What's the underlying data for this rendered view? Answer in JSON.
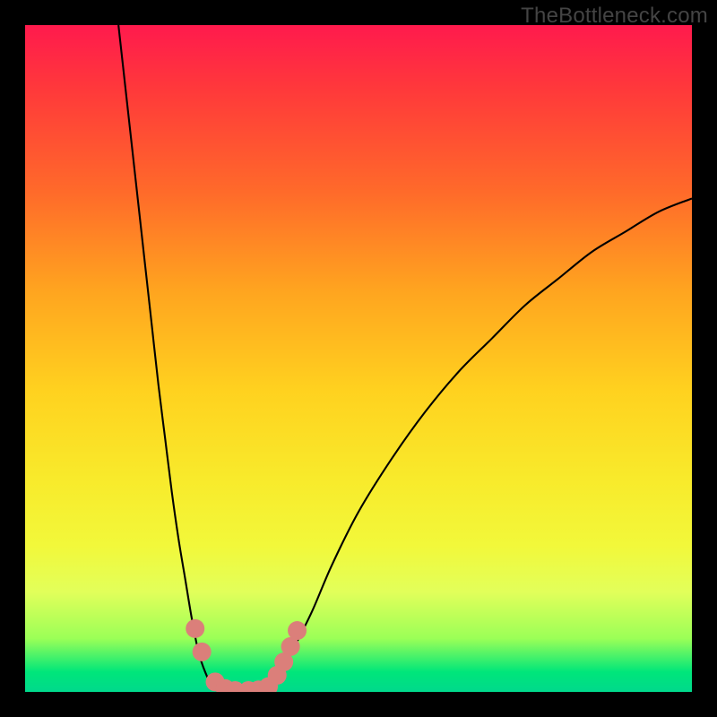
{
  "watermark": "TheBottleneck.com",
  "chart_data": {
    "type": "line",
    "title": "",
    "xlabel": "",
    "ylabel": "",
    "xlim": [
      0,
      100
    ],
    "ylim": [
      0,
      100
    ],
    "grid": false,
    "legend": null,
    "notes": "Bottleneck percentage curve. Two thin black curves descend from top; left branch from ~x=14 at top down to valley; right branch from ~x=100,y≈74 down to valley. Valley floor (y≈0) spans roughly x=28..37. Salmon-colored rounded markers cluster along the bottom of both branches near the valley.",
    "series": [
      {
        "name": "left-branch",
        "type": "line",
        "x": [
          14,
          15,
          16,
          17,
          18,
          19,
          20,
          21,
          22,
          23,
          24,
          25,
          26,
          27,
          28,
          29
        ],
        "y": [
          100,
          91,
          82,
          73,
          64,
          55,
          46,
          38,
          30,
          23,
          17,
          11,
          6,
          3,
          1,
          0
        ]
      },
      {
        "name": "valley-floor",
        "type": "line",
        "x": [
          29,
          30,
          31,
          32,
          33,
          34,
          35,
          36,
          37
        ],
        "y": [
          0,
          0,
          0,
          0,
          0,
          0,
          0,
          0,
          0
        ]
      },
      {
        "name": "right-branch",
        "type": "line",
        "x": [
          37,
          38,
          40,
          43,
          46,
          50,
          55,
          60,
          65,
          70,
          75,
          80,
          85,
          90,
          95,
          100
        ],
        "y": [
          0,
          2,
          6,
          12,
          19,
          27,
          35,
          42,
          48,
          53,
          58,
          62,
          66,
          69,
          72,
          74
        ]
      },
      {
        "name": "markers",
        "type": "scatter",
        "color": "#db7f7a",
        "points": [
          {
            "x": 25.5,
            "y": 9.5
          },
          {
            "x": 26.5,
            "y": 6.0
          },
          {
            "x": 28.5,
            "y": 1.5
          },
          {
            "x": 30.0,
            "y": 0.5
          },
          {
            "x": 31.5,
            "y": 0.2
          },
          {
            "x": 33.5,
            "y": 0.2
          },
          {
            "x": 35.0,
            "y": 0.3
          },
          {
            "x": 36.5,
            "y": 0.8
          },
          {
            "x": 37.8,
            "y": 2.5
          },
          {
            "x": 38.8,
            "y": 4.5
          },
          {
            "x": 39.8,
            "y": 6.8
          },
          {
            "x": 40.8,
            "y": 9.2
          }
        ]
      }
    ],
    "background_gradient": {
      "top": "#ff1a4d",
      "bottom": "#00d98c"
    }
  }
}
